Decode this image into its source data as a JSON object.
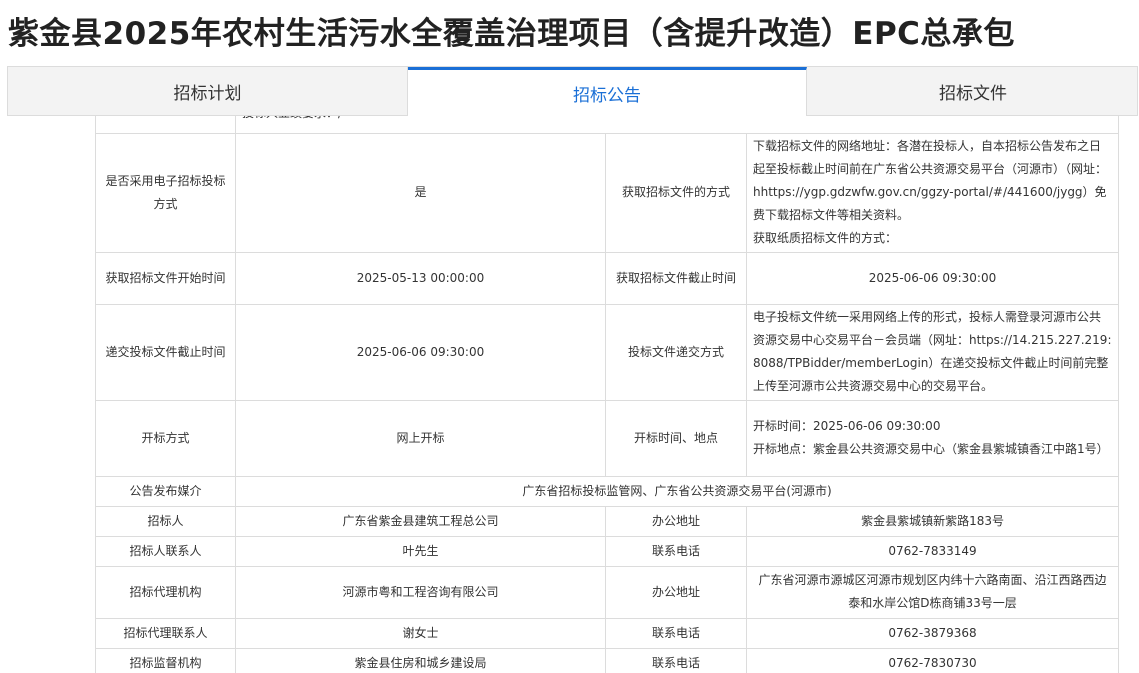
{
  "page": {
    "title": "紫金县2025年农村生活污水全覆盖治理项目（含提升改造）EPC总承包"
  },
  "tabs": [
    {
      "label": "招标计划",
      "active": false
    },
    {
      "label": "招标公告",
      "active": true
    },
    {
      "label": "招标文件",
      "active": false
    }
  ],
  "table": {
    "partial_top_row_text": "投标人业绩要求：/",
    "rows": {
      "electronic": {
        "label": "是否采用电子招标投标方式",
        "value": "是"
      },
      "obtain_method": {
        "label": "获取招标文件的方式",
        "lines": [
          "下载招标文件的网络地址：各潜在投标人，自本招标公告发布之日起至投标截止时间前在广东省公共资源交易平台（河源市）（网址：hhttps://ygp.gdzwfw.gov.cn/ggzy-portal/#/441600/jygg）免费下载招标文件等相关资料。",
          "获取纸质招标文件的方式："
        ]
      },
      "obtain_start": {
        "label": "获取招标文件开始时间",
        "value": "2025-05-13 00:00:00"
      },
      "obtain_end": {
        "label": "获取招标文件截止时间",
        "value": "2025-06-06 09:30:00"
      },
      "submit_deadline": {
        "label": "递交投标文件截止时间",
        "value": "2025-06-06 09:30:00"
      },
      "submit_method": {
        "label": "投标文件递交方式",
        "value": "电子投标文件统一采用网络上传的形式，投标人需登录河源市公共资源交易中心交易平台－会员端（网址：https://14.215.227.219:8088/TPBidder/memberLogin）在递交投标文件截止时间前完整上传至河源市公共资源交易中心的交易平台。"
      },
      "open_method": {
        "label": "开标方式",
        "value": "网上开标"
      },
      "open_time_place": {
        "label": "开标时间、地点",
        "time": "开标时间：2025-06-06 09:30:00",
        "place": "开标地点：紫金县公共资源交易中心（紫金县紫城镇香江中路1号）"
      },
      "media": {
        "label": "公告发布媒介",
        "value": "广东省招标投标监管网、广东省公共资源交易平台(河源市)"
      },
      "tenderer": {
        "label": "招标人",
        "value": "广东省紫金县建筑工程总公司"
      },
      "tenderer_address": {
        "label": "办公地址",
        "value": "紫金县紫城镇新紫路183号"
      },
      "tenderer_contact": {
        "label": "招标人联系人",
        "value": "叶先生"
      },
      "tenderer_phone": {
        "label": "联系电话",
        "value": "0762-7833149"
      },
      "agency": {
        "label": "招标代理机构",
        "value": "河源市粤和工程咨询有限公司"
      },
      "agency_address": {
        "label": "办公地址",
        "value": "广东省河源市源城区河源市规划区内纬十六路南面、沿江西路西边泰和水岸公馆D栋商铺33号一层"
      },
      "agency_contact": {
        "label": "招标代理联系人",
        "value": "谢女士"
      },
      "agency_phone": {
        "label": "联系电话",
        "value": "0762-3879368"
      },
      "supervisor": {
        "label": "招标监督机构",
        "value": "紫金县住房和城乡建设局"
      },
      "supervisor_phone": {
        "label": "联系电话",
        "value": "0762-7830730"
      }
    }
  },
  "colors": {
    "accent": "#1a6fd6",
    "tab_bg": "#f3f3f3",
    "border": "#dcdcdc",
    "text": "#333333"
  }
}
